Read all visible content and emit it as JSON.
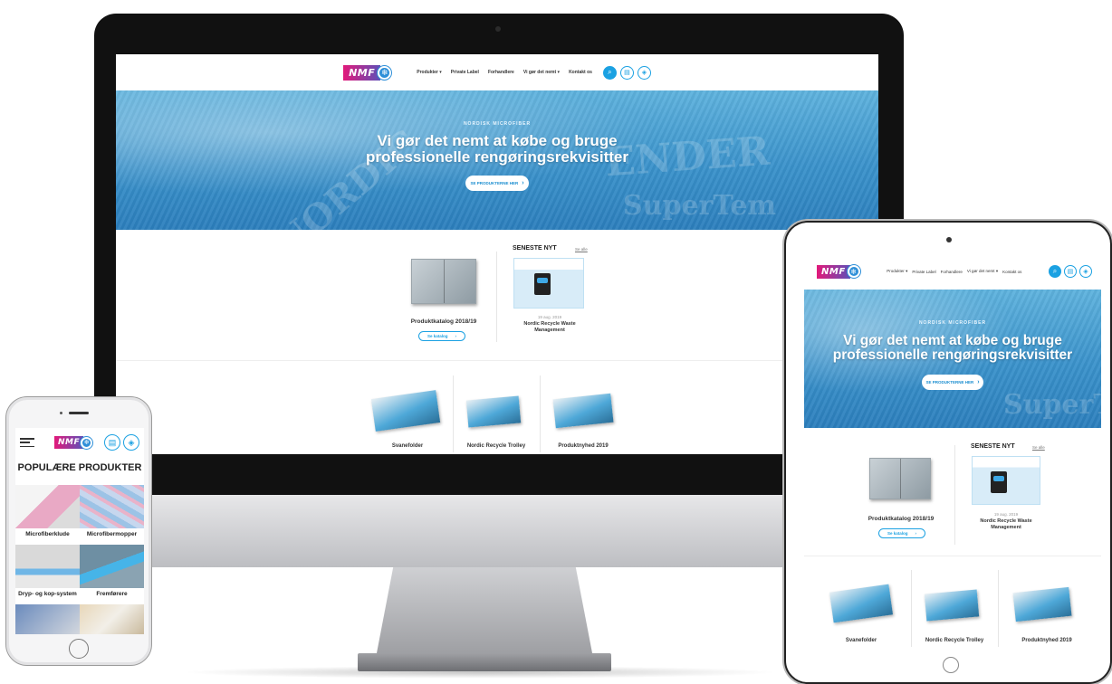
{
  "site": {
    "logo_text": "NMF",
    "nav": {
      "items": [
        "Produkter",
        "Private Label",
        "Forhandlere",
        "Vi gør det nemt",
        "Kontakt os"
      ],
      "dropdown_flags": [
        true,
        false,
        false,
        true,
        false
      ]
    },
    "hero": {
      "eyebrow": "NORDISK MICROFIBER",
      "headline_line1": "Vi gør det nemt at købe og bruge",
      "headline_line2": "professionelle rengøringsrekvisitter",
      "cta_label": "SE PRODUKTERNE HER",
      "watermark_1": "ENDER",
      "watermark_2": "NORDIC",
      "watermark_3": "SuperTem"
    },
    "catalog": {
      "title": "Produktkatalog 2018/19",
      "button_label": "Se katalog"
    },
    "latest": {
      "title": "SENESTE NYT",
      "see_all": "Se alle",
      "date": "19 aug. 2019",
      "article_title": "Nordic Recycle Waste Management"
    },
    "categories": [
      {
        "title": "Svanefolder"
      },
      {
        "title": "Nordic Recycle Trolley"
      },
      {
        "title": "Produktnyhed 2019"
      }
    ],
    "chevron": "›"
  },
  "mobile": {
    "section_title": "POPULÆRE PRODUKTER",
    "tiles": [
      {
        "label": "Microfiberklude"
      },
      {
        "label": "Microfibermopper"
      },
      {
        "label": "Dryp- og kop-system"
      },
      {
        "label": "Fremførere"
      }
    ]
  },
  "colors": {
    "accent": "#1ba1e2",
    "hero_blue": "#3a92cb",
    "logo_pink": "#e2197a"
  }
}
